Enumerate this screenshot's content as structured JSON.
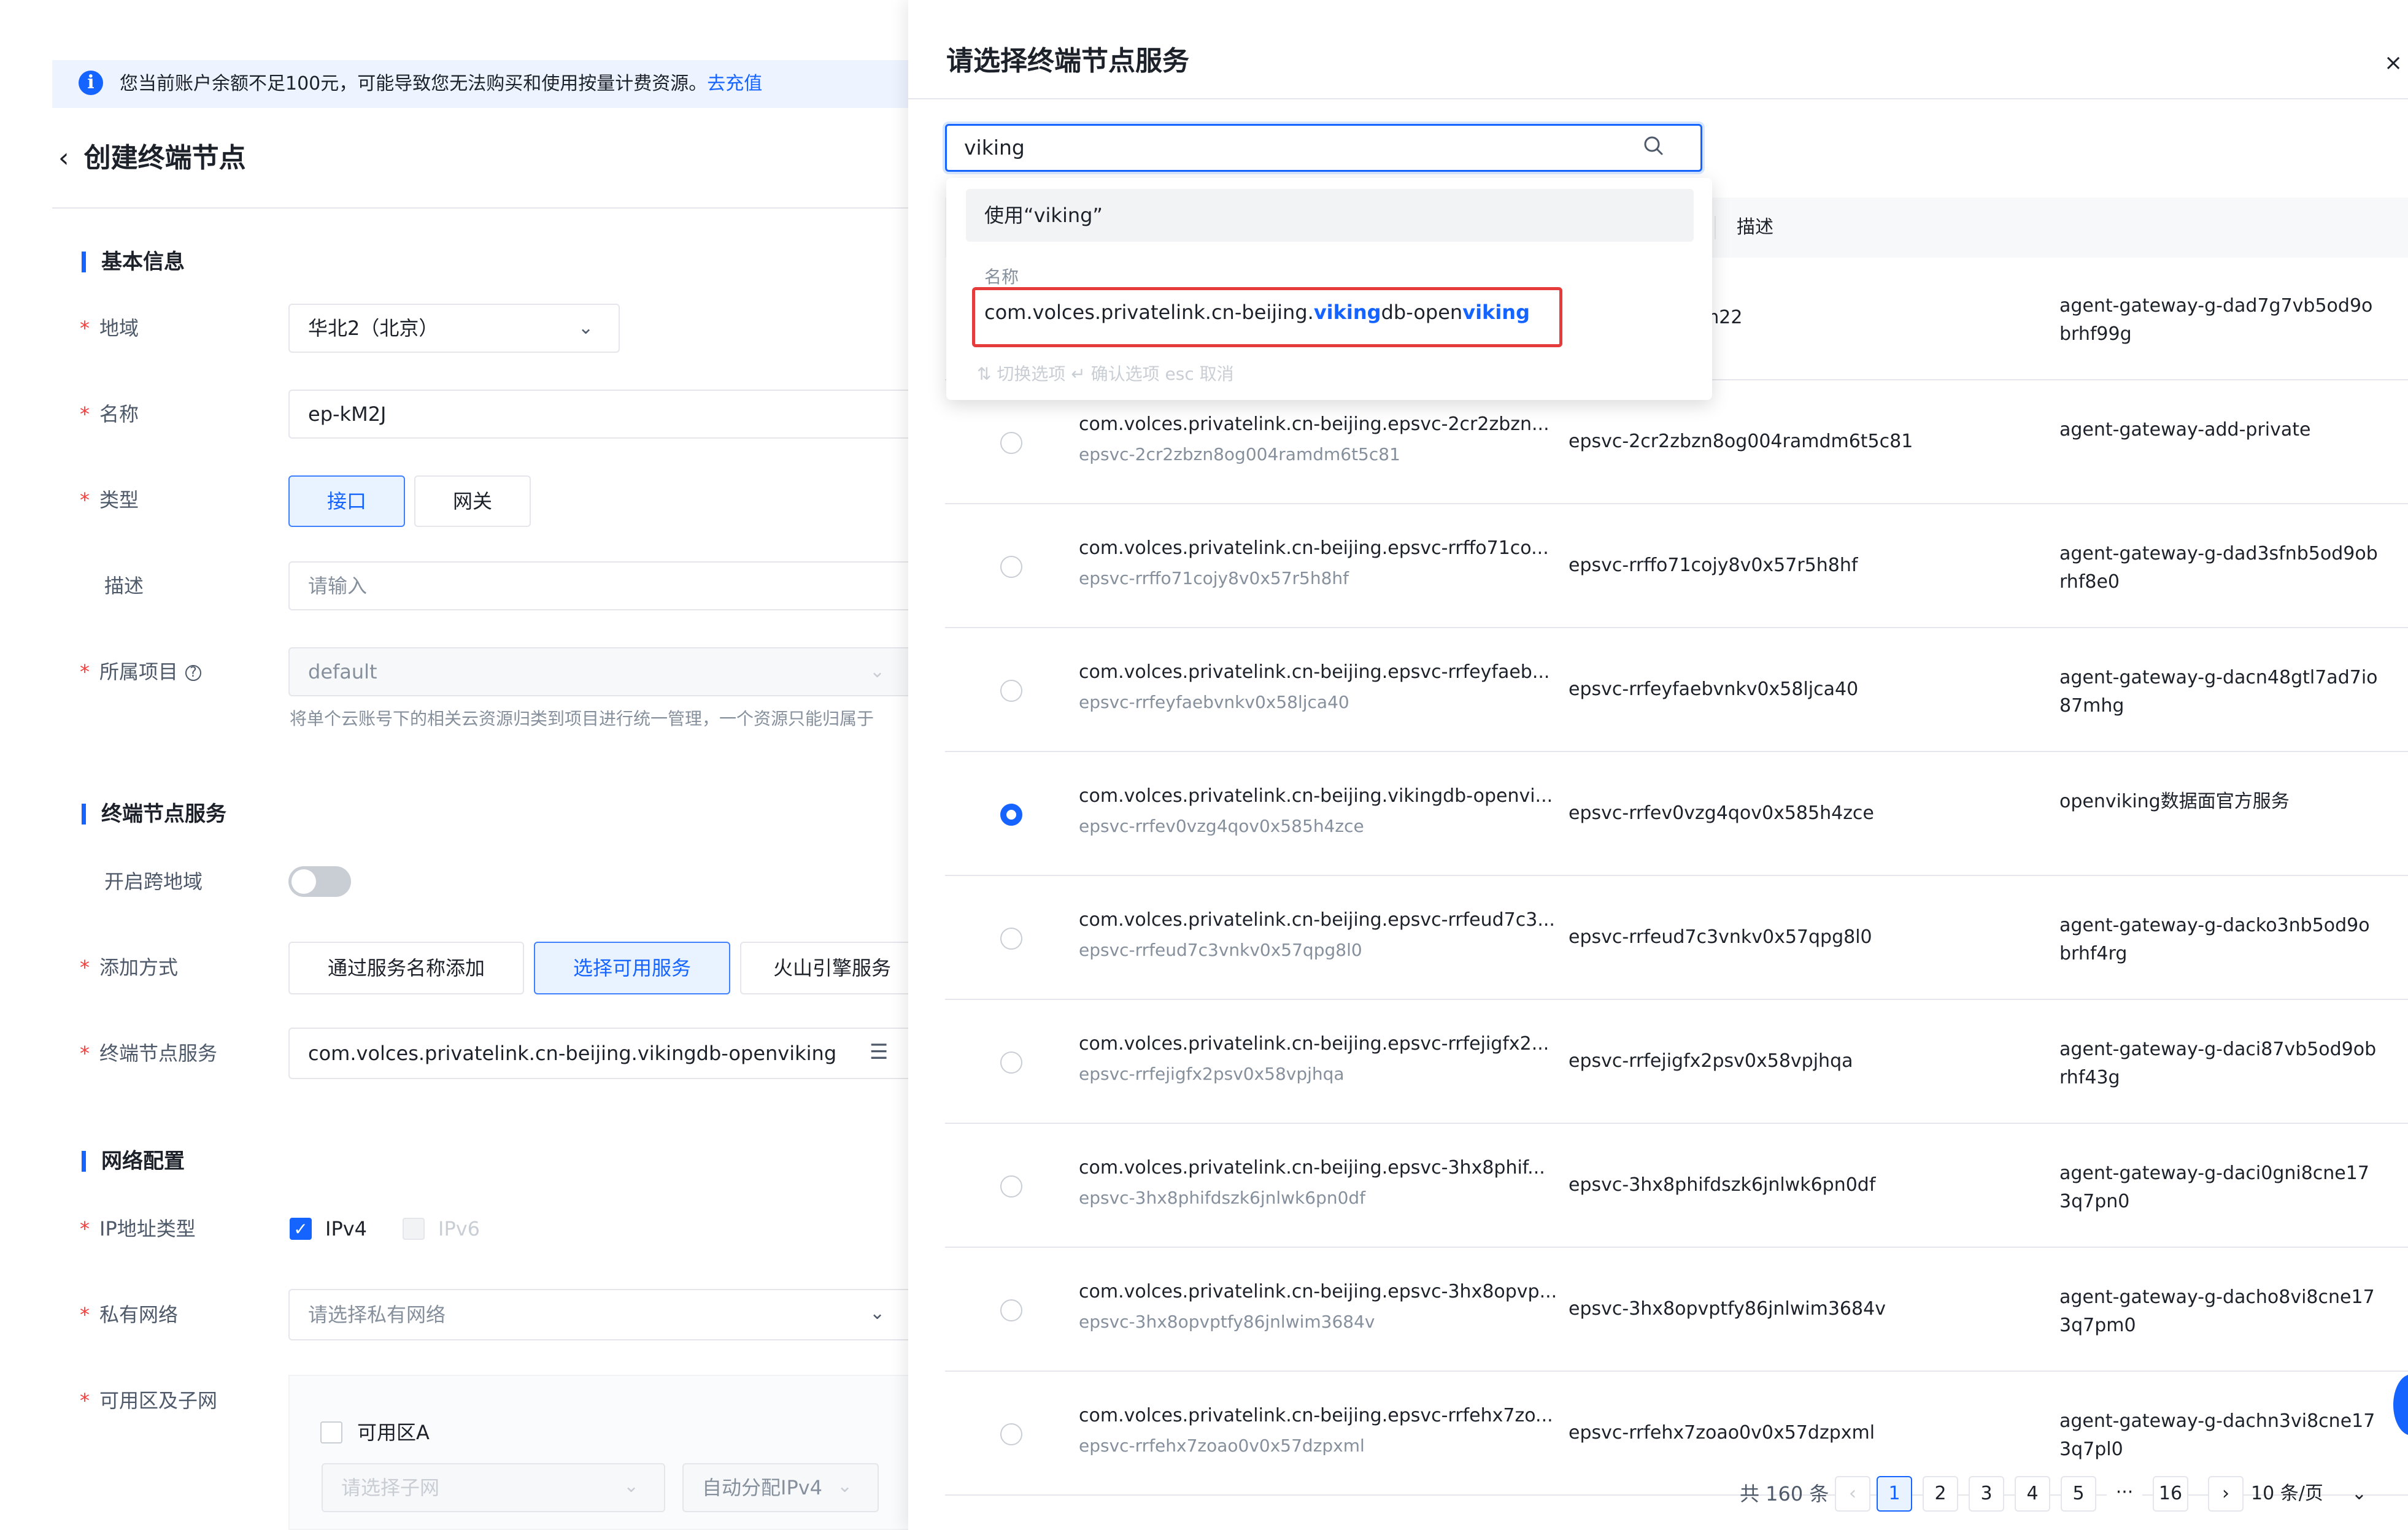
{
  "notice": {
    "text": "您当前账户余额不足100元，可能导致您无法购买和使用按量计费资源。",
    "link": "去充值"
  },
  "page": {
    "back": "‹",
    "title": "创建终端节点"
  },
  "sections": {
    "basic": "基本信息",
    "service": "终端节点服务",
    "network": "网络配置"
  },
  "form": {
    "region": {
      "label": "地域",
      "value": "华北2（北京）"
    },
    "name": {
      "label": "名称",
      "value": "ep-kM2J"
    },
    "type": {
      "label": "类型",
      "options": [
        "接口",
        "网关"
      ],
      "selected": "接口"
    },
    "desc": {
      "label": "描述",
      "placeholder": "请输入"
    },
    "project": {
      "label": "所属项目",
      "value": "default",
      "hint": "将单个云账号下的相关云资源归类到项目进行统一管理，一个资源只能归属于"
    },
    "cross_region": {
      "label": "开启跨地域",
      "enabled": false
    },
    "add_method": {
      "label": "添加方式",
      "options": [
        "通过服务名称添加",
        "选择可用服务",
        "火山引擎服务"
      ],
      "selected": "选择可用服务"
    },
    "endpoint_service": {
      "label": "终端节点服务",
      "value": "com.volces.privatelink.cn-beijing.vikingdb-openviking"
    },
    "ip_type": {
      "label": "IP地址类型",
      "ipv4": "IPv4",
      "ipv6": "IPv6",
      "ipv4_checked": true
    },
    "vpc": {
      "label": "私有网络",
      "placeholder": "请选择私有网络"
    },
    "zone": {
      "label": "可用区及子网",
      "zone_a": "可用区A",
      "subnet_placeholder": "请选择子网",
      "ip_assign": "自动分配IPv4"
    }
  },
  "drawer": {
    "title": "请选择终端节点服务",
    "close": "×",
    "search_value": "viking",
    "dropdown": {
      "use_option": "使用“viking”",
      "group_label": "名称",
      "option_prefix": "com.volces.privatelink.cn-beijing.",
      "option_hl1": "viking",
      "option_mid": "db-open",
      "option_hl2": "viking",
      "key_hints": "⇅ 切换选项   ↵ 确认选项   esc 取消"
    },
    "table": {
      "headers": [
        "",
        "描述"
      ],
      "rows": [
        {
          "name": "",
          "sub": "",
          "id": "av41m4hscoism22",
          "desc": "agent-gateway-g-dad7g7vb5od9obrhf99g",
          "selected": false
        },
        {
          "name": "com.volces.privatelink.cn-beijing.epsvc-2cr2zbzn...",
          "sub": "epsvc-2cr2zbzn8og004ramdm6t5c81",
          "id": "epsvc-2cr2zbzn8og004ramdm6t5c81",
          "desc": "agent-gateway-add-private",
          "selected": false
        },
        {
          "name": "com.volces.privatelink.cn-beijing.epsvc-rrffo71co...",
          "sub": "epsvc-rrffo71cojy8v0x57r5h8hf",
          "id": "epsvc-rrffo71cojy8v0x57r5h8hf",
          "desc": "agent-gateway-g-dad3sfnb5od9obrhf8e0",
          "selected": false
        },
        {
          "name": "com.volces.privatelink.cn-beijing.epsvc-rrfeyfaeb...",
          "sub": "epsvc-rrfeyfaebvnkv0x58ljca40",
          "id": "epsvc-rrfeyfaebvnkv0x58ljca40",
          "desc": "agent-gateway-g-dacn48gtl7ad7io87mhg",
          "selected": false
        },
        {
          "name": "com.volces.privatelink.cn-beijing.vikingdb-openvi...",
          "sub": "epsvc-rrfev0vzg4qov0x585h4zce",
          "id": "epsvc-rrfev0vzg4qov0x585h4zce",
          "desc": "openviking数据面官方服务",
          "selected": true
        },
        {
          "name": "com.volces.privatelink.cn-beijing.epsvc-rrfeud7c3...",
          "sub": "epsvc-rrfeud7c3vnkv0x57qpg8l0",
          "id": "epsvc-rrfeud7c3vnkv0x57qpg8l0",
          "desc": "agent-gateway-g-dacko3nb5od9obrhf4rg",
          "selected": false
        },
        {
          "name": "com.volces.privatelink.cn-beijing.epsvc-rrfejigfx2...",
          "sub": "epsvc-rrfejigfx2psv0x58vpjhqa",
          "id": "epsvc-rrfejigfx2psv0x58vpjhqa",
          "desc": "agent-gateway-g-daci87vb5od9obrhf43g",
          "selected": false
        },
        {
          "name": "com.volces.privatelink.cn-beijing.epsvc-3hx8phif...",
          "sub": "epsvc-3hx8phifdszk6jnlwk6pn0df",
          "id": "epsvc-3hx8phifdszk6jnlwk6pn0df",
          "desc": "agent-gateway-g-daci0gni8cne173q7pn0",
          "selected": false
        },
        {
          "name": "com.volces.privatelink.cn-beijing.epsvc-3hx8opvp...",
          "sub": "epsvc-3hx8opvptfy86jnlwim3684v",
          "id": "epsvc-3hx8opvptfy86jnlwim3684v",
          "desc": "agent-gateway-g-dacho8vi8cne173q7pm0",
          "selected": false
        },
        {
          "name": "com.volces.privatelink.cn-beijing.epsvc-rrfehx7zo...",
          "sub": "epsvc-rrfehx7zoao0v0x57dzpxml",
          "id": "epsvc-rrfehx7zoao0v0x57dzpxml",
          "desc": "agent-gateway-g-dachn3vi8cne173q7pl0",
          "selected": false
        }
      ]
    },
    "pagination": {
      "total": "共 160 条",
      "pages": [
        "1",
        "2",
        "3",
        "4",
        "5",
        "···",
        "16"
      ],
      "current": "1",
      "prev": "‹",
      "next": "›",
      "page_size": "10 条/页"
    }
  }
}
